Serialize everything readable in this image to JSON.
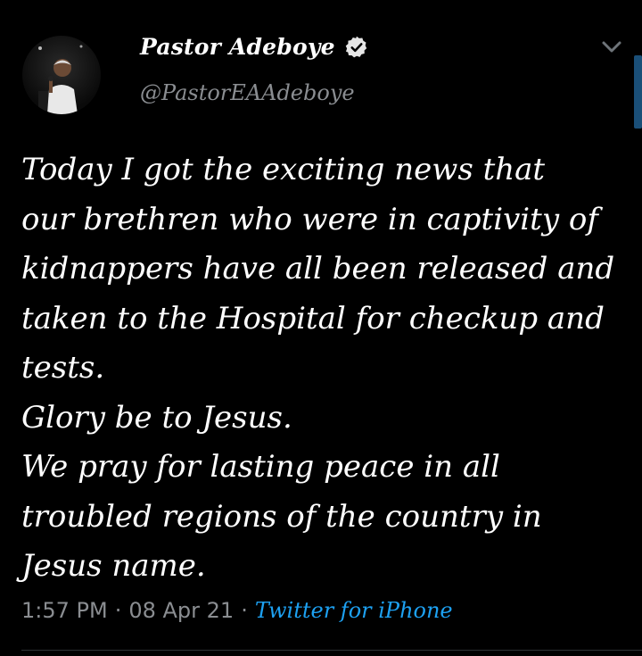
{
  "tweet": {
    "display_name": "Pastor Adeboye",
    "handle": "@PastorEAAdeboye",
    "verified": true,
    "avatar_icon": "user-avatar",
    "body_lines": [
      "Today I got the exciting news that",
      "our brethren who were in captivity of",
      "kidnappers have all been released and",
      "taken to the Hospital for checkup and",
      "tests.",
      "Glory be to Jesus.",
      "We pray for lasting peace in all",
      "troubled regions of the country in",
      "Jesus name."
    ],
    "time": "1:57 PM",
    "date": "08 Apr 21",
    "separator": "·",
    "source": "Twitter for iPhone"
  },
  "colors": {
    "background": "#000000",
    "text": "#ffffff",
    "secondary_text": "#8a8d91",
    "link": "#1da1f2",
    "scrollbar": "#1a4f78"
  }
}
